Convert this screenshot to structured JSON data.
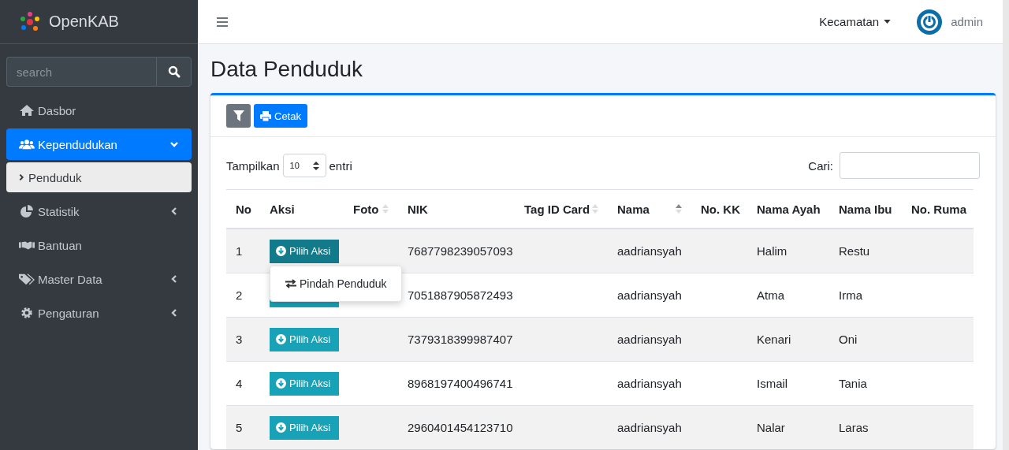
{
  "brand": {
    "name": "OpenKAB"
  },
  "sidebar": {
    "search": {
      "placeholder": "search"
    },
    "items": [
      {
        "label": "Dasbor",
        "selected": false
      },
      {
        "label": "Kependudukan",
        "selected": true,
        "expanded": true,
        "children": [
          {
            "label": "Penduduk",
            "selected": true
          }
        ]
      },
      {
        "label": "Statistik",
        "selected": false,
        "expanded": false
      },
      {
        "label": "Bantuan",
        "selected": false
      },
      {
        "label": "Master Data",
        "selected": false,
        "expanded": false
      },
      {
        "label": "Pengaturan",
        "selected": false,
        "expanded": false
      }
    ]
  },
  "topbar": {
    "dropdown": "Kecamatan",
    "user": "admin"
  },
  "page_title": "Data Penduduk",
  "toolbar": {
    "print_button": "Cetak"
  },
  "length": {
    "label_before": "Tampilkan",
    "value": "10",
    "label_after": "entri"
  },
  "search": {
    "label": "Cari:"
  },
  "table": {
    "columns": [
      {
        "label": "No"
      },
      {
        "label": "Aksi"
      },
      {
        "label": "Foto",
        "sorted": false
      },
      {
        "label": "NIK"
      },
      {
        "label": "Tag ID Card",
        "sorted": false
      },
      {
        "label": "Nama",
        "sorted": true
      },
      {
        "label": "No. KK"
      },
      {
        "label": "Nama Ayah"
      },
      {
        "label": "Nama Ibu"
      },
      {
        "label": "No. Ruma"
      }
    ],
    "rows": [
      {
        "no": "1",
        "action": "Pilih Aksi",
        "active": true,
        "nik": "7687798239057093",
        "nama": "aadriansyah",
        "ayah": "Halim",
        "ibu": "Restu"
      },
      {
        "no": "2",
        "nik": "7051887905872493",
        "nama": "aadriansyah",
        "ayah": "Atma",
        "ibu": "Irma"
      },
      {
        "no": "3",
        "action": "Pilih Aksi",
        "active": false,
        "nik": "7379318399987407",
        "nama": "aadriansyah",
        "ayah": "Kenari",
        "ibu": "Oni"
      },
      {
        "no": "4",
        "action": "Pilih Aksi",
        "active": false,
        "nik": "8968197400496741",
        "nama": "aadriansyah",
        "ayah": "Ismail",
        "ibu": "Tania"
      },
      {
        "no": "5",
        "action": "Pilih Aksi",
        "active": false,
        "nik": "2960401454123710",
        "nama": "aadriansyah",
        "ayah": "Nalar",
        "ibu": "Laras"
      }
    ]
  },
  "action_menu": {
    "items": [
      "Pindah Penduduk"
    ]
  }
}
